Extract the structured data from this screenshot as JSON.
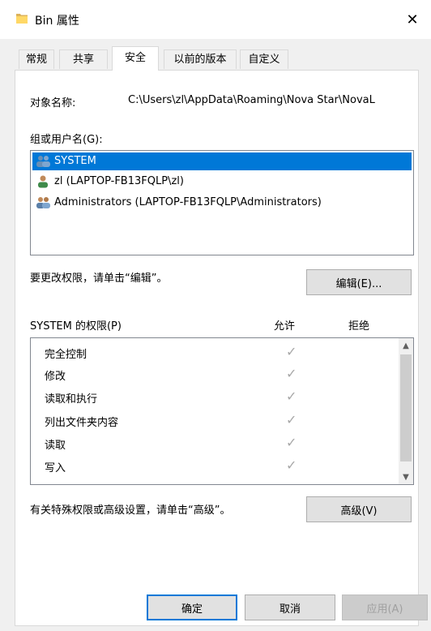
{
  "window": {
    "title": "Bin 属性",
    "close_glyph": "✕"
  },
  "tabs": [
    {
      "label": "常规",
      "active": false
    },
    {
      "label": "共享",
      "active": false
    },
    {
      "label": "安全",
      "active": true
    },
    {
      "label": "以前的版本",
      "active": false
    },
    {
      "label": "自定义",
      "active": false
    }
  ],
  "security": {
    "object_name_label": "对象名称:",
    "object_name_value": "C:\\Users\\zl\\AppData\\Roaming\\Nova Star\\NovaL",
    "groups_label": "组或用户名(G):",
    "users": [
      {
        "name": "SYSTEM",
        "selected": true,
        "icon": "user-group-icon"
      },
      {
        "name": "zl (LAPTOP-FB13FQLP\\zl)",
        "selected": false,
        "icon": "user-icon"
      },
      {
        "name": "Administrators (LAPTOP-FB13FQLP\\Administrators)",
        "selected": false,
        "icon": "user-group-icon"
      }
    ],
    "edit_hint": "要更改权限，请单击“编辑”。",
    "edit_button": "编辑(E)...",
    "permissions_label": "SYSTEM 的权限(P)",
    "allow_header": "允许",
    "deny_header": "拒绝",
    "permissions": [
      {
        "name": "完全控制",
        "allow": "✓",
        "deny": ""
      },
      {
        "name": "修改",
        "allow": "✓",
        "deny": ""
      },
      {
        "name": "读取和执行",
        "allow": "✓",
        "deny": ""
      },
      {
        "name": "列出文件夹内容",
        "allow": "✓",
        "deny": ""
      },
      {
        "name": "读取",
        "allow": "✓",
        "deny": ""
      },
      {
        "name": "写入",
        "allow": "✓",
        "deny": ""
      }
    ],
    "advanced_hint": "有关特殊权限或高级设置，请单击“高级”。",
    "advanced_button": "高级(V)"
  },
  "footer": {
    "ok": "确定",
    "cancel": "取消",
    "apply": "应用(A)"
  },
  "colors": {
    "selection": "#0078d7",
    "check": "#a8a8a8",
    "folder": "#dcb35c"
  }
}
